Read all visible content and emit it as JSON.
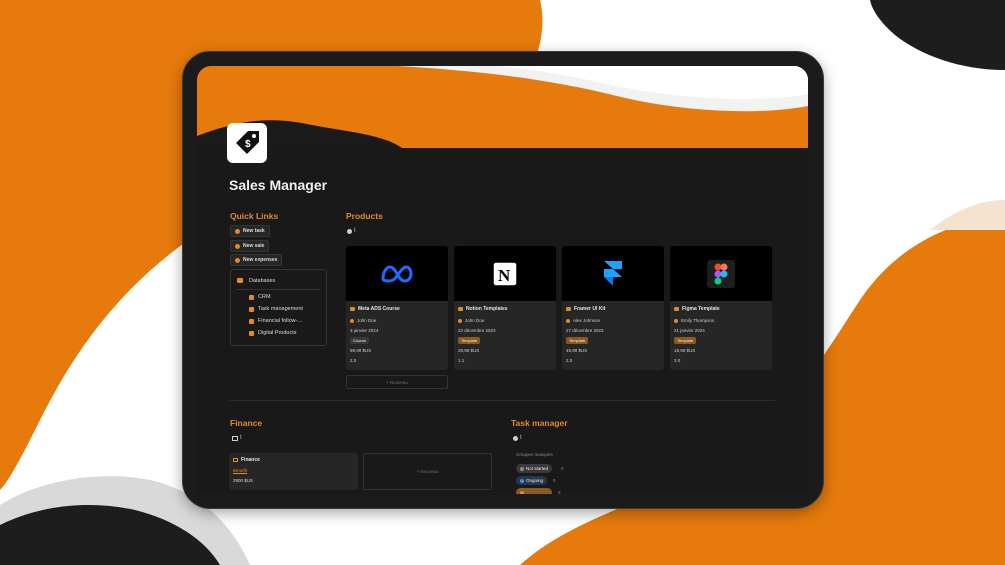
{
  "colors": {
    "accent": "#e67a0c",
    "screen_bg": "#191919",
    "card_bg": "#262626"
  },
  "page": {
    "title": "Sales Manager",
    "icon": "price-tag-icon"
  },
  "quick_links": {
    "title": "Quick Links",
    "buttons": [
      "New task",
      "New sale",
      "New expenses"
    ],
    "databases": {
      "title": "Databases",
      "items": [
        "CRM",
        "Task management",
        "Financial follow-...",
        "Digital Products"
      ]
    }
  },
  "products": {
    "title": "Products",
    "view_label": "I",
    "new_label": "+ Nouveau",
    "cards": [
      {
        "name": "Meta ADS Course",
        "author": "John Doe",
        "date": "3 janvier 2024",
        "tag": "Course",
        "price": "99,99 $US",
        "rating": "2.0",
        "logo": "meta-logo-icon"
      },
      {
        "name": "Notion Templates",
        "author": "John Doe",
        "date": "22 décembre 2023",
        "tag": "Template",
        "price": "29,99 $US",
        "rating": "1.1",
        "logo": "notion-logo-icon"
      },
      {
        "name": "Framer UI Kit",
        "author": "Alex Johnson",
        "date": "27 décembre 2023",
        "tag": "Template",
        "price": "49,99 $US",
        "rating": "2.0",
        "logo": "framer-logo-icon"
      },
      {
        "name": "Figma Template",
        "author": "Emily Thompson",
        "date": "21 janvier 2024",
        "tag": "Template",
        "price": "19,99 $US",
        "rating": "3.0",
        "logo": "figma-logo-icon"
      }
    ]
  },
  "finance": {
    "title": "Finance",
    "view_label": "I",
    "card": {
      "name": "Finance",
      "link": "Benefit",
      "value": "2900 $US"
    },
    "new_label": "+ Nouveau"
  },
  "task_manager": {
    "title": "Task manager",
    "view_label": "I",
    "hidden_groups_label": "Groupes masqués",
    "statuses": [
      {
        "label": "Not started",
        "count": "0",
        "color": "#8a8a8a"
      },
      {
        "label": "Ongoing",
        "count": "0",
        "color": "#4a90d9"
      },
      {
        "label": "",
        "count": "0",
        "color": "#e08a2a"
      }
    ]
  }
}
